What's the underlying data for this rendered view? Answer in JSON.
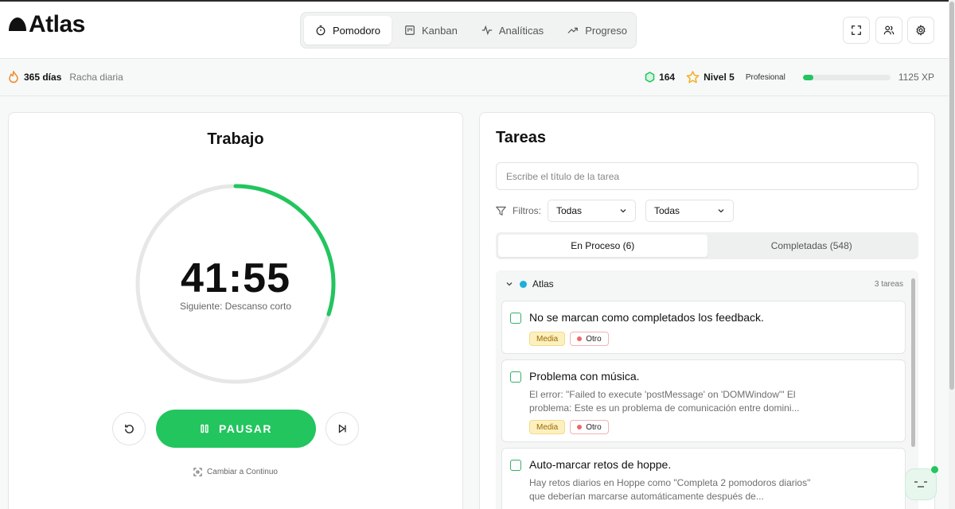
{
  "app": {
    "name": "Atlas"
  },
  "nav": {
    "items": [
      {
        "label": "Pomodoro",
        "icon": "timer-icon",
        "active": true
      },
      {
        "label": "Kanban",
        "icon": "kanban-icon",
        "active": false
      },
      {
        "label": "Analíticas",
        "icon": "activity-icon",
        "active": false
      },
      {
        "label": "Progreso",
        "icon": "trending-up-icon",
        "active": false
      }
    ]
  },
  "header_actions": [
    "fullscreen-icon",
    "users-icon",
    "settings-icon"
  ],
  "status": {
    "streak_days": "365 días",
    "streak_label": "Racha diaria",
    "gems": "164",
    "level": "Nivel 5",
    "rank": "Profesional",
    "xp_progress": 0.12,
    "xp": "1125 XP"
  },
  "timer": {
    "mode": "Trabajo",
    "time": "41:55",
    "next": "Siguiente: Descanso corto",
    "progress": 0.3,
    "pause_label": "PAUSAR",
    "switch_label": "Cambiar a Continuo"
  },
  "tasks": {
    "title": "Tareas",
    "input_placeholder": "Escribe el título de la tarea",
    "filters_label": "Filtros:",
    "filter_1": "Todas",
    "filter_2": "Todas",
    "tab_in_progress": "En Proceso (6)",
    "tab_completed": "Completadas (548)",
    "group": {
      "name": "Atlas",
      "count": "3 tareas",
      "color": "#1cb0d8"
    },
    "items": [
      {
        "title": "No se marcan como completados los feedback.",
        "desc": "",
        "priority": "Media",
        "category": "Otro"
      },
      {
        "title": "Problema con música.",
        "desc": "El error: \"Failed to execute 'postMessage' on 'DOMWindow'\" El problema: Este es un problema de comunicación entre domini...",
        "priority": "Media",
        "category": "Otro"
      },
      {
        "title": "Auto-marcar retos de hoppe.",
        "desc": "Hay retos diarios en Hoppe como \"Completa 2 pomodoros diarios\" que deberían marcarse automáticamente después de...",
        "priority": "",
        "category": ""
      }
    ]
  },
  "colors": {
    "accent": "#22c55e",
    "streak": "#f08a2a",
    "star": "#f2b01e"
  }
}
